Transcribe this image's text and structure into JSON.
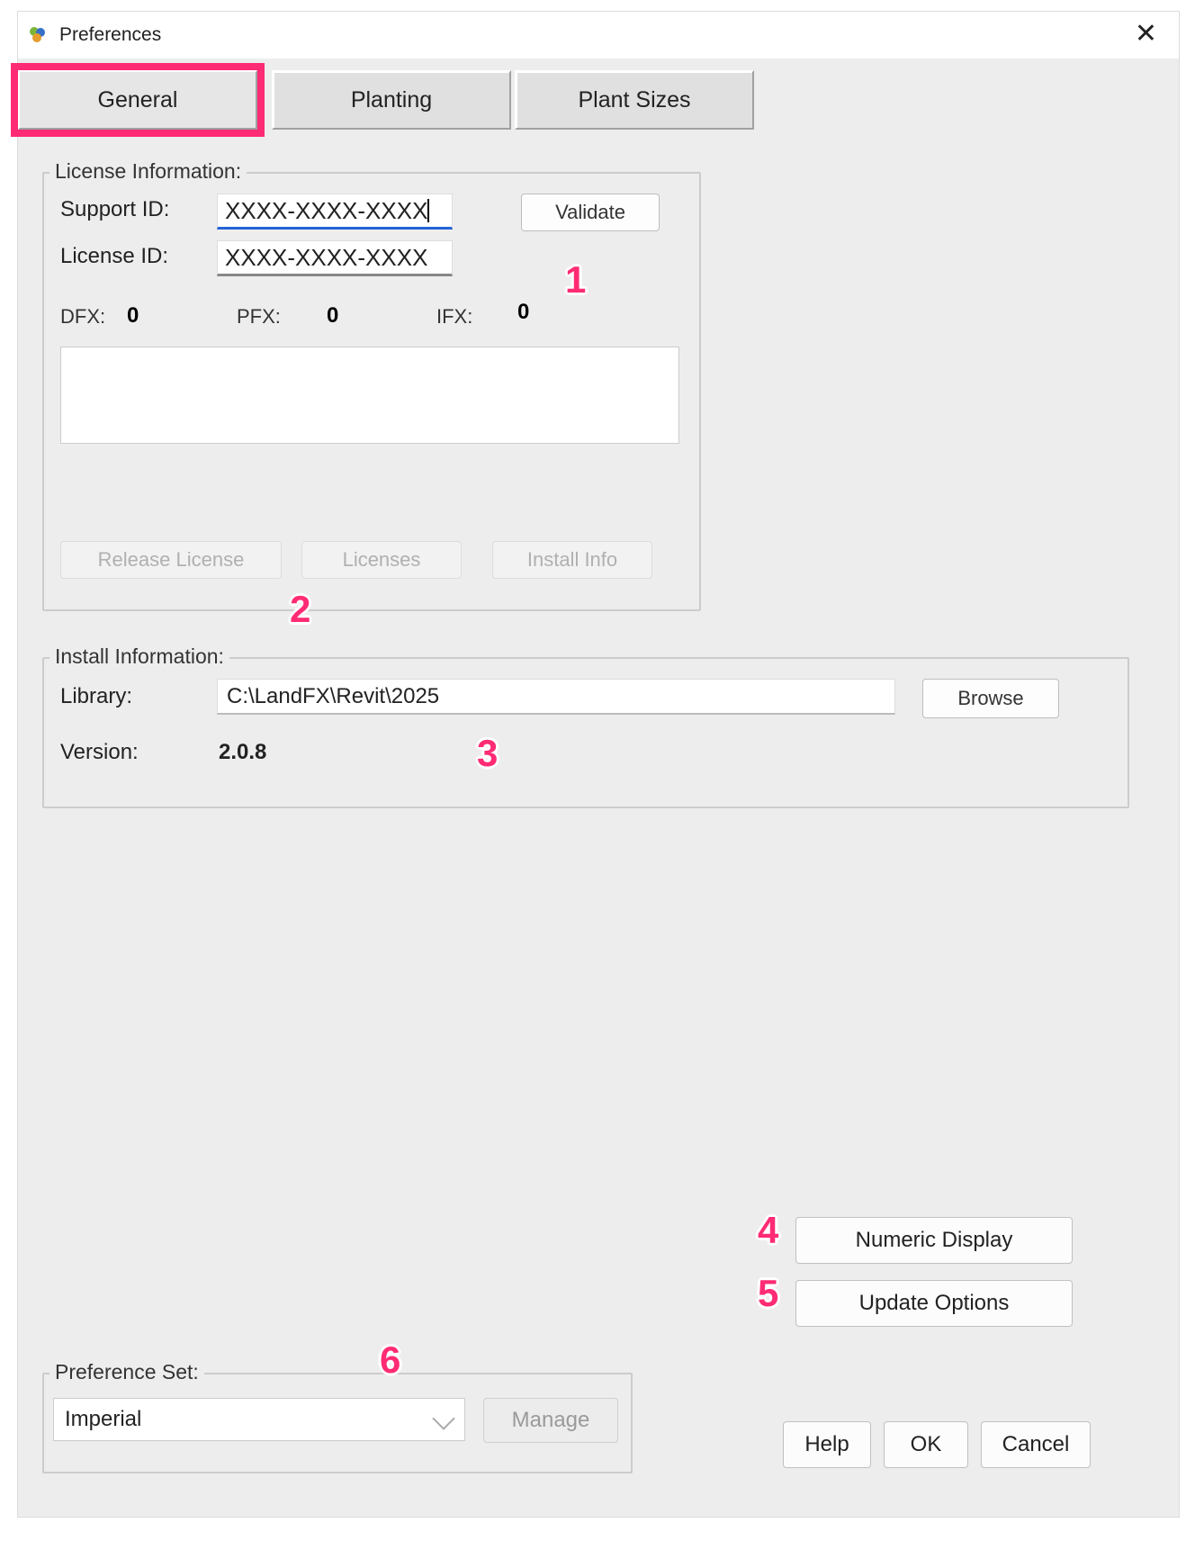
{
  "window": {
    "title": "Preferences"
  },
  "tabs": {
    "general": "General",
    "planting": "Planting",
    "plant_sizes": "Plant Sizes",
    "active": "General"
  },
  "license": {
    "group_title": "License Information:",
    "support_id_label": "Support ID:",
    "support_id_value": "XXXX-XXXX-XXXX",
    "license_id_label": "License ID:",
    "license_id_value": "XXXX-XXXX-XXXX",
    "validate_label": "Validate",
    "dfx_label": "DFX:",
    "dfx_value": "0",
    "pfx_label": "PFX:",
    "pfx_value": "0",
    "ifx_label": "IFX:",
    "ifx_value": "0",
    "release_license_label": "Release License",
    "licenses_label": "Licenses",
    "install_info_label": "Install Info"
  },
  "install": {
    "group_title": "Install Information:",
    "library_label": "Library:",
    "library_path": "C:\\LandFX\\Revit\\2025",
    "browse_label": "Browse",
    "version_label": "Version:",
    "version_value": "2.0.8"
  },
  "right_buttons": {
    "numeric_display": "Numeric Display",
    "update_options": "Update Options"
  },
  "pref_set": {
    "group_title": "Preference Set:",
    "selected": "Imperial",
    "manage_label": "Manage"
  },
  "bottom": {
    "help": "Help",
    "ok": "OK",
    "cancel": "Cancel"
  },
  "callouts": {
    "c1": "1",
    "c2": "2",
    "c3": "3",
    "c4": "4",
    "c5": "5",
    "c6": "6"
  }
}
